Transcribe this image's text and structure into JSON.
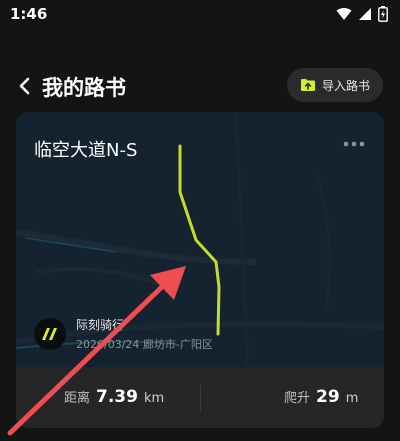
{
  "status": {
    "time": "1:46"
  },
  "header": {
    "title": "我的路书",
    "import_label": "导入路书"
  },
  "card": {
    "route_name": "临空大道N-S",
    "creator_name": "际刻骑行",
    "meta": "2026/03/24 廊坊市-广阳区",
    "distance_label": "距离",
    "distance_value": "7.39",
    "distance_unit": "km",
    "climb_label": "爬升",
    "climb_value": "29",
    "climb_unit": "m"
  },
  "colors": {
    "route_line": "#c3dd2a",
    "annotation_arrow": "#ef4d50",
    "accent": "#d4ef32"
  }
}
